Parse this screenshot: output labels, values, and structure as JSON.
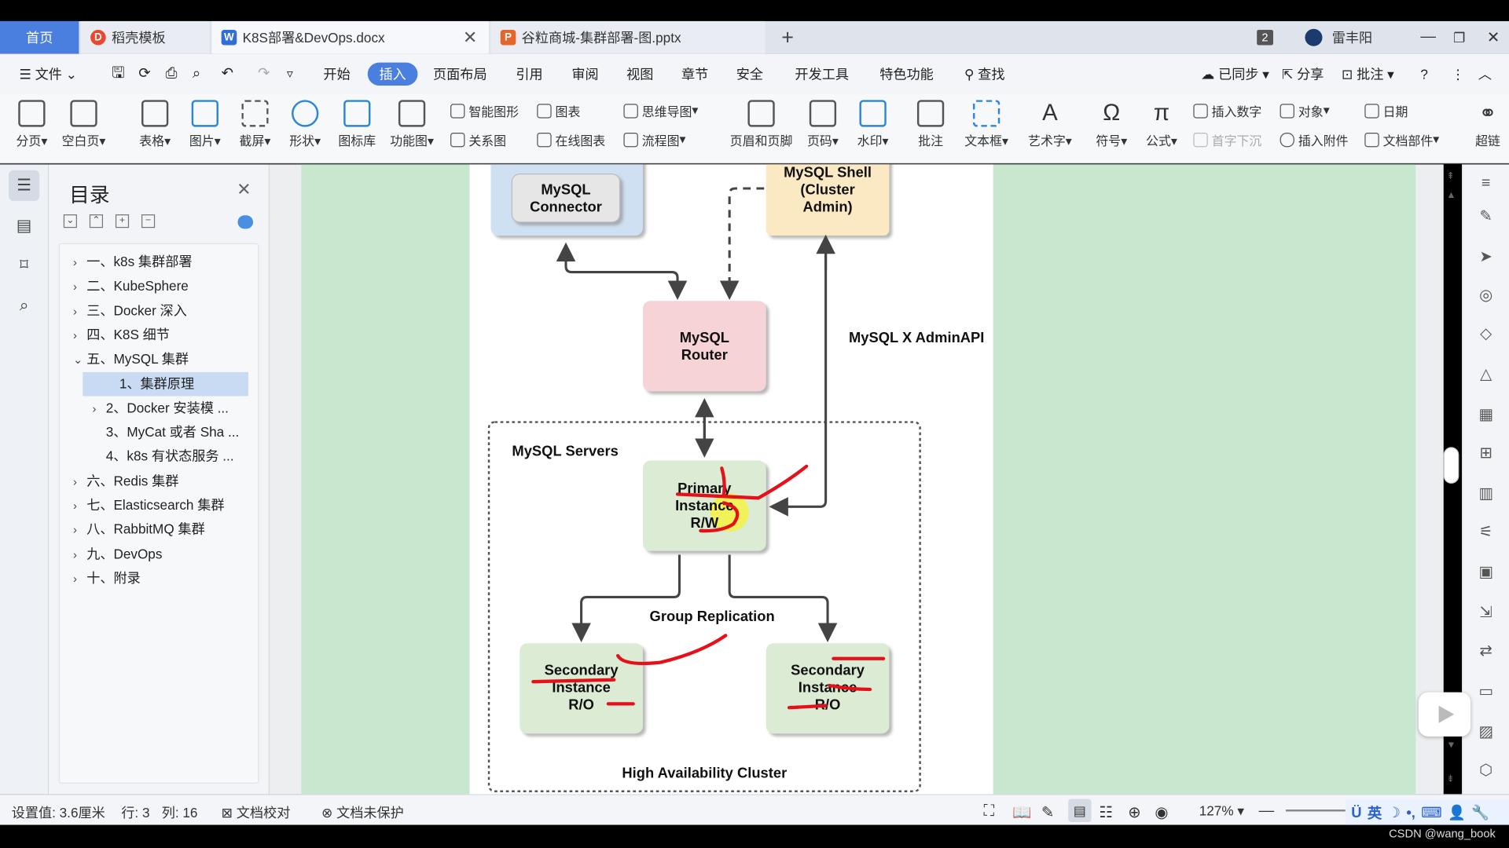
{
  "titlebar": {
    "tabs": [
      {
        "label": "首页"
      },
      {
        "label": "稻壳模板"
      },
      {
        "label": "K8S部署&DevOps.docx"
      },
      {
        "label": "谷粒商城-集群部署-图.pptx"
      }
    ],
    "badge": "2",
    "user": "雷丰阳"
  },
  "menu": {
    "file": "文件",
    "items": [
      "开始",
      "插入",
      "页面布局",
      "引用",
      "审阅",
      "视图",
      "章节",
      "安全",
      "开发工具",
      "特色功能"
    ],
    "search": "查找",
    "sync": "已同步",
    "share": "分享",
    "comment": "批注"
  },
  "ribbon": {
    "big": [
      "分页",
      "空白页",
      "表格",
      "图片",
      "截屏",
      "形状",
      "图标库",
      "功能图",
      "页眉和页脚",
      "页码",
      "水印",
      "批注",
      "文本框",
      "艺术字",
      "符号",
      "公式",
      "超链"
    ],
    "small_col1": [
      "智能图形",
      "关系图"
    ],
    "small_col2": [
      "图表",
      "在线图表"
    ],
    "small_col3": [
      "思维导图",
      "流程图"
    ],
    "small_col4": [
      "插入数字",
      "首字下沉"
    ],
    "small_col5": [
      "对象",
      "插入附件"
    ],
    "small_col6": [
      "日期",
      "文档部件"
    ]
  },
  "toc": {
    "title": "目录",
    "items": [
      {
        "label": "一、k8s 集群部署",
        "expand": "›"
      },
      {
        "label": "二、KubeSphere",
        "expand": "›"
      },
      {
        "label": "三、Docker 深入",
        "expand": "›"
      },
      {
        "label": "四、K8S 细节",
        "expand": "›"
      },
      {
        "label": "五、MySQL 集群",
        "expand": "⌄"
      },
      {
        "label": "1、集群原理",
        "expand": ""
      },
      {
        "label": "2、Docker 安装模 ...",
        "expand": "›"
      },
      {
        "label": "3、MyCat 或者 Sha ...",
        "expand": ""
      },
      {
        "label": "4、k8s 有状态服务 ...",
        "expand": ""
      },
      {
        "label": "六、Redis 集群",
        "expand": "›"
      },
      {
        "label": "七、Elasticsearch 集群",
        "expand": "›"
      },
      {
        "label": "八、RabbitMQ 集群",
        "expand": "›"
      },
      {
        "label": "九、DevOps",
        "expand": "›"
      },
      {
        "label": "十、附录",
        "expand": "›"
      }
    ]
  },
  "diagram": {
    "connector": [
      "MySQL",
      "Connector"
    ],
    "shell": [
      "MySQL Shell",
      "(Cluster",
      "Admin)"
    ],
    "router": [
      "MySQL",
      "Router"
    ],
    "adminapi": "MySQL X AdminAPI",
    "servers": "MySQL Servers",
    "primary": [
      "Primary",
      "Instance",
      "R/W"
    ],
    "replication": "Group Replication",
    "secondary1": [
      "Secondary",
      "Instance",
      "R/O"
    ],
    "secondary2": [
      "Secondary",
      "Instance",
      "R/O"
    ],
    "cluster": "High Availability Cluster"
  },
  "status": {
    "setting": "设置值: 3.6厘米",
    "row": "行: 3",
    "col": "列: 16",
    "proof": "文档校对",
    "protect": "文档未保护",
    "zoom": "127%",
    "ime": "英"
  },
  "watermark": "CSDN @wang_book"
}
